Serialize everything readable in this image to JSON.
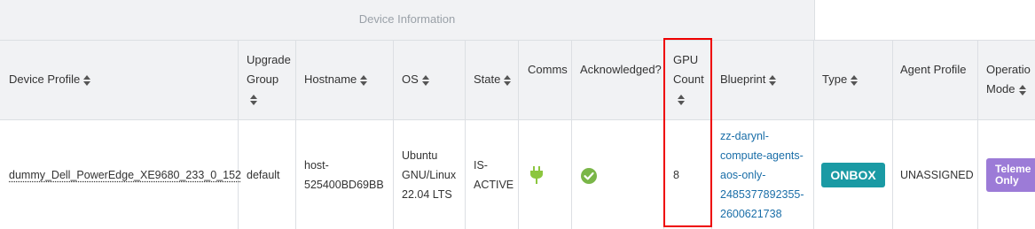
{
  "group_header": {
    "title": "Device Information"
  },
  "columns": {
    "device_profile": "Device Profile",
    "upgrade_group_1": "Upgrade",
    "upgrade_group_2": "Group",
    "hostname": "Hostname",
    "os": "OS",
    "state": "State",
    "comms": "Comms",
    "acknowledged": "Acknowledged?",
    "gpu_count_1": "GPU",
    "gpu_count_2": "Count",
    "blueprint": "Blueprint",
    "type": "Type",
    "agent_profile": "Agent Profile",
    "operation_mode_1": "Operatio",
    "operation_mode_2": "Mode"
  },
  "row": {
    "device_profile": "dummy_Dell_PowerEdge_XE9680_233_0_152",
    "upgrade_group": "default",
    "hostname_1": "host-",
    "hostname_2": "525400BD69BB",
    "os_1": "Ubuntu",
    "os_2": "GNU/Linux",
    "os_3": "22.04 LTS",
    "state_1": "IS-",
    "state_2": "ACTIVE",
    "comms_icon": "plug-icon",
    "acknowledged_icon": "check-circle-icon",
    "gpu_count": "8",
    "blueprint_lines": [
      "zz-darynl-",
      "compute-agents-",
      "aos-only-",
      "2485377892355-",
      "2600621738"
    ],
    "type": "ONBOX",
    "agent_profile": "UNASSIGNED",
    "operation_mode_1": "Teleme",
    "operation_mode_2": "Only"
  },
  "colors": {
    "header_bg": "#f1f2f4",
    "link": "#1a6ea8",
    "onbox": "#1a9aa4",
    "telemetry": "#9c7bd7",
    "plug": "#8cc63f",
    "check": "#7ab648",
    "highlight": "#e00000"
  }
}
